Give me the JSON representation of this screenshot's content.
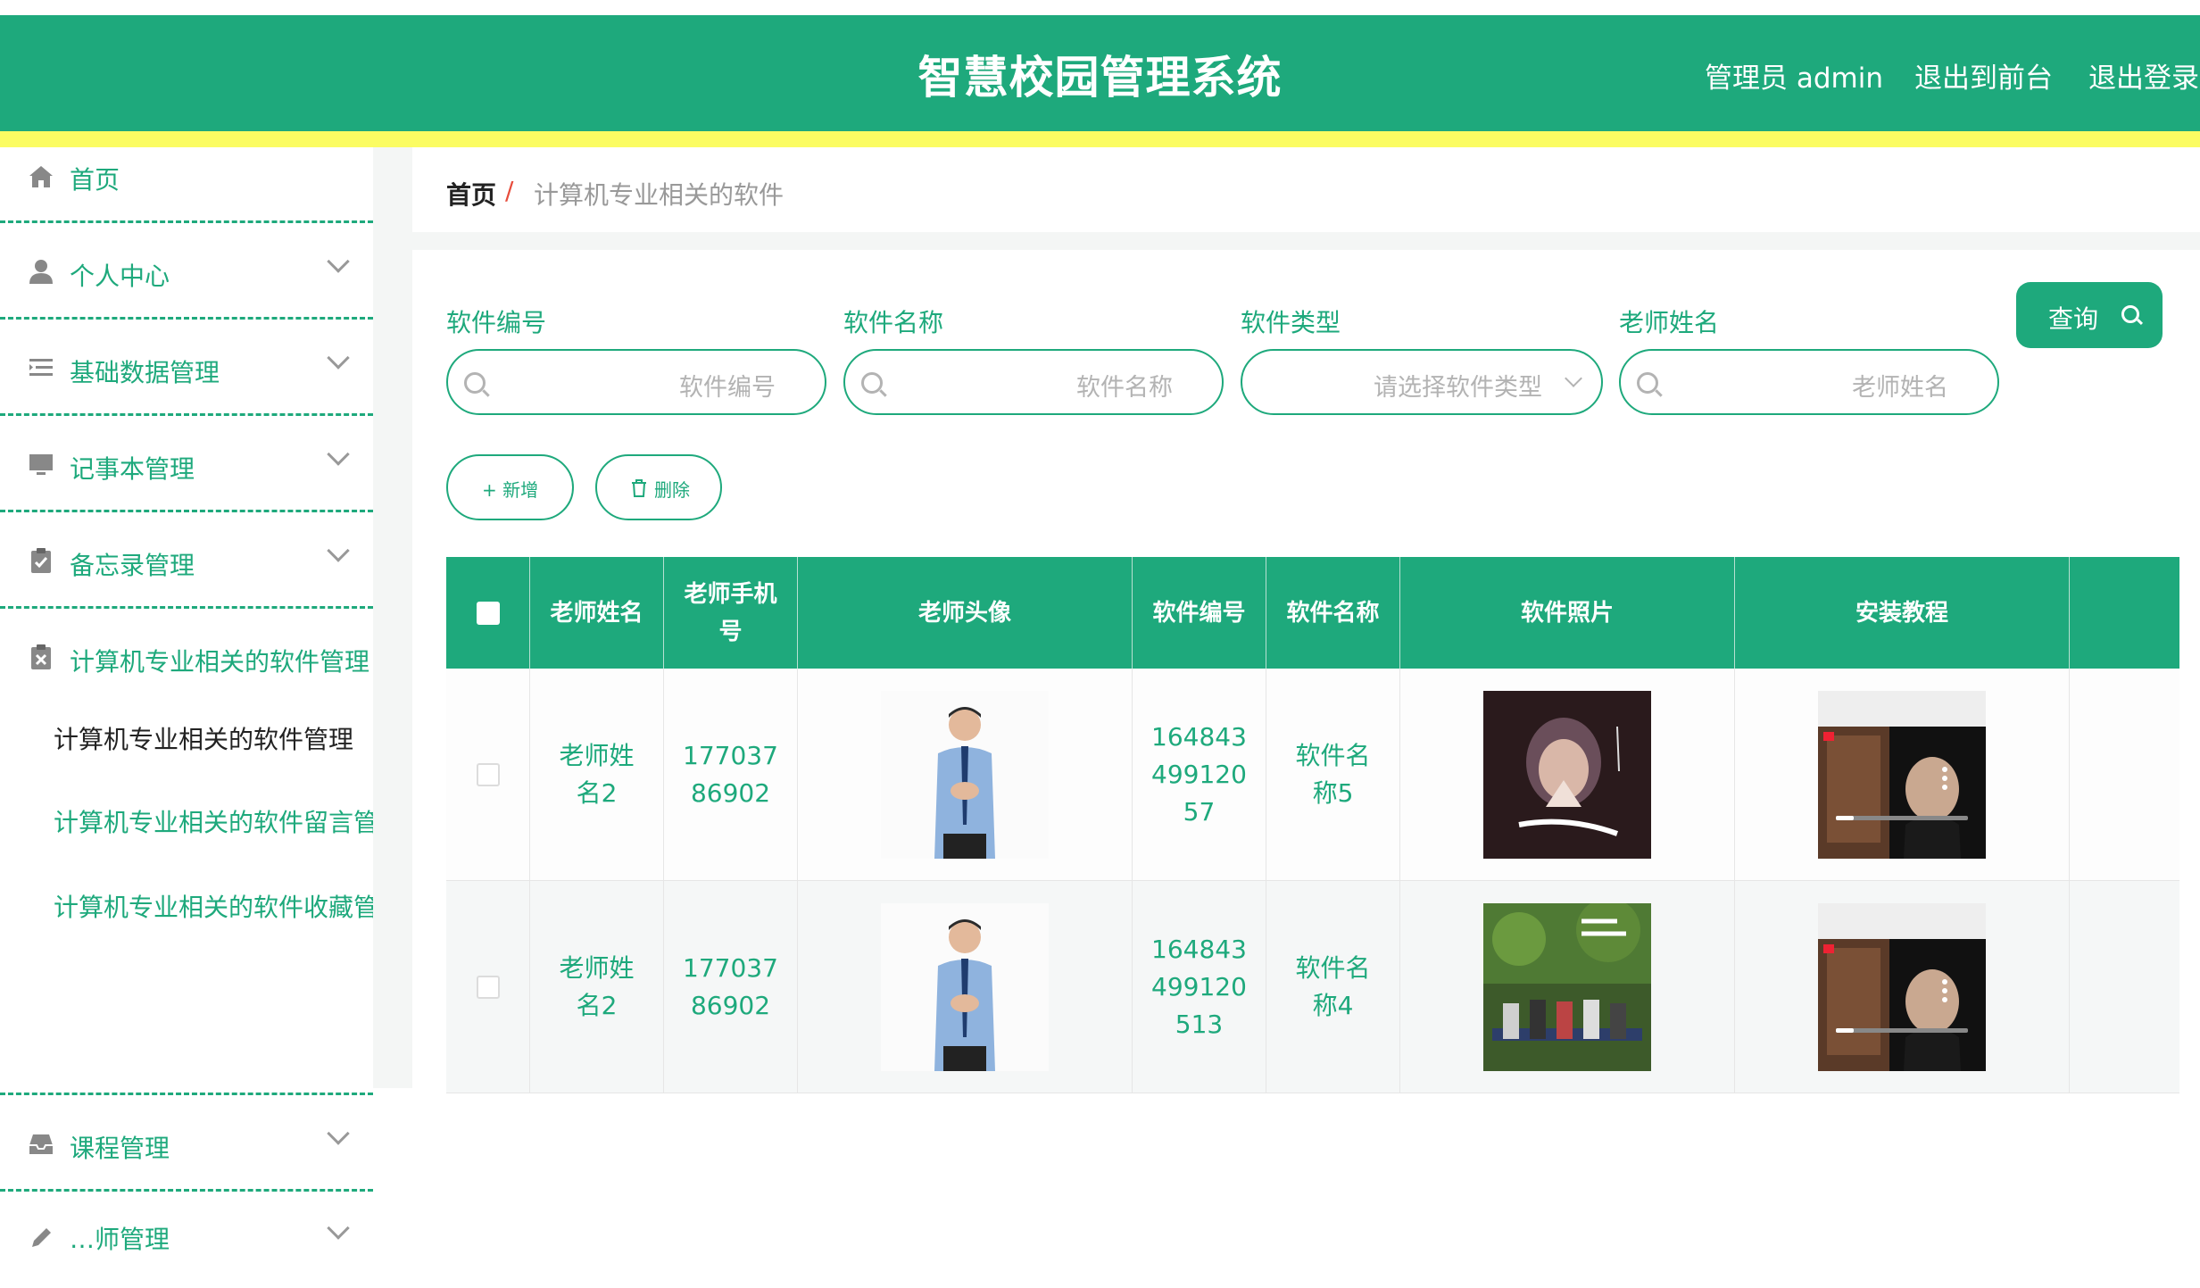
{
  "header": {
    "title": "智慧校园管理系统",
    "admin": "管理员 admin",
    "to_front": "退出到前台",
    "logout": "退出登录"
  },
  "sidebar": {
    "items": [
      {
        "label": "首页",
        "icon": "home-icon"
      },
      {
        "label": "个人中心",
        "icon": "user-icon"
      },
      {
        "label": "基础数据管理",
        "icon": "list-icon"
      },
      {
        "label": "记事本管理",
        "icon": "monitor-icon"
      },
      {
        "label": "备忘录管理",
        "icon": "clipboard-check-icon"
      },
      {
        "label": "计算机专业相关的软件管理",
        "icon": "clipboard-x-icon"
      },
      {
        "label": "课程管理",
        "icon": "inbox-icon"
      },
      {
        "label": "…师管理",
        "icon": "edit-icon"
      }
    ],
    "subitems": [
      "计算机专业相关的软件管理",
      "计算机专业相关的软件留言管理",
      "计算机专业相关的软件收藏管理"
    ]
  },
  "breadcrumb": {
    "home": "首页",
    "separator": "/",
    "current": "计算机专业相关的软件"
  },
  "filters": [
    {
      "label": "软件编号",
      "placeholder": "软件编号"
    },
    {
      "label": "软件名称",
      "placeholder": "软件名称"
    },
    {
      "label": "软件类型",
      "placeholder": "请选择软件类型"
    },
    {
      "label": "老师姓名",
      "placeholder": "老师姓名"
    }
  ],
  "buttons": {
    "query": "查询",
    "add": "+ 新增",
    "delete": "删除"
  },
  "table": {
    "headers": [
      "老师姓名",
      "老师手机号",
      "老师头像",
      "软件编号",
      "软件名称",
      "软件照片",
      "安装教程"
    ],
    "rows": [
      {
        "teacher": "老师姓名2",
        "phone": "17703786902",
        "code": "16484349912057",
        "name": "软件名称5"
      },
      {
        "teacher": "老师姓名2",
        "phone": "17703786902",
        "code": "164843499120513",
        "name": "软件名称4"
      }
    ]
  },
  "colors": {
    "primary": "#1ea97c",
    "accent_bar": "#fbfc62",
    "danger": "#e74c3c"
  }
}
